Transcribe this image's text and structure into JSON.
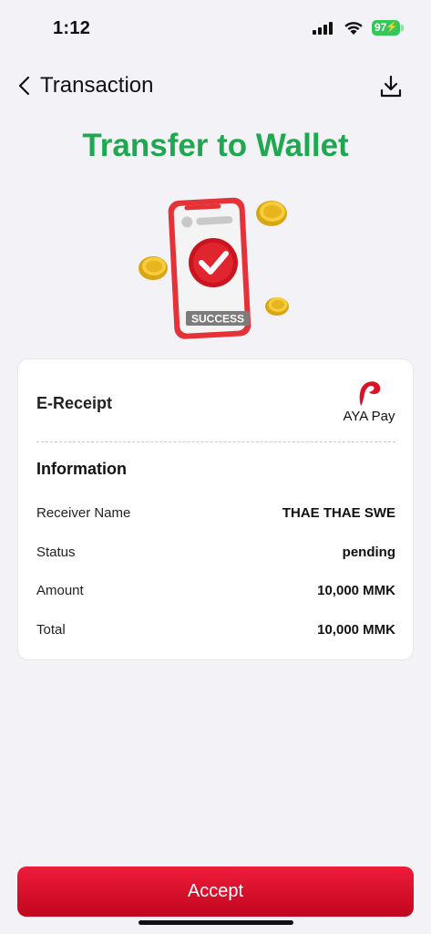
{
  "status_bar": {
    "time": "1:12",
    "battery": "97"
  },
  "nav": {
    "title": "Transaction"
  },
  "heading": "Transfer to Wallet",
  "illustration": {
    "badge": "SUCCESS"
  },
  "receipt": {
    "title": "E-Receipt",
    "brand": "AYA Pay",
    "section_title": "Information",
    "rows": [
      {
        "label": "Receiver Name",
        "value": "THAE THAE SWE"
      },
      {
        "label": "Status",
        "value": "pending"
      },
      {
        "label": "Amount",
        "value": "10,000 MMK"
      },
      {
        "label": "Total",
        "value": "10,000 MMK"
      }
    ]
  },
  "accept_label": "Accept",
  "colors": {
    "heading": "#1fa84f",
    "accent": "#e3102f",
    "battery": "#34c759"
  },
  "icons": [
    "back-chevron-icon",
    "download-icon",
    "signal-icon",
    "wifi-icon",
    "battery-icon",
    "success-check-icon",
    "coin-icon",
    "aya-pay-logo"
  ]
}
